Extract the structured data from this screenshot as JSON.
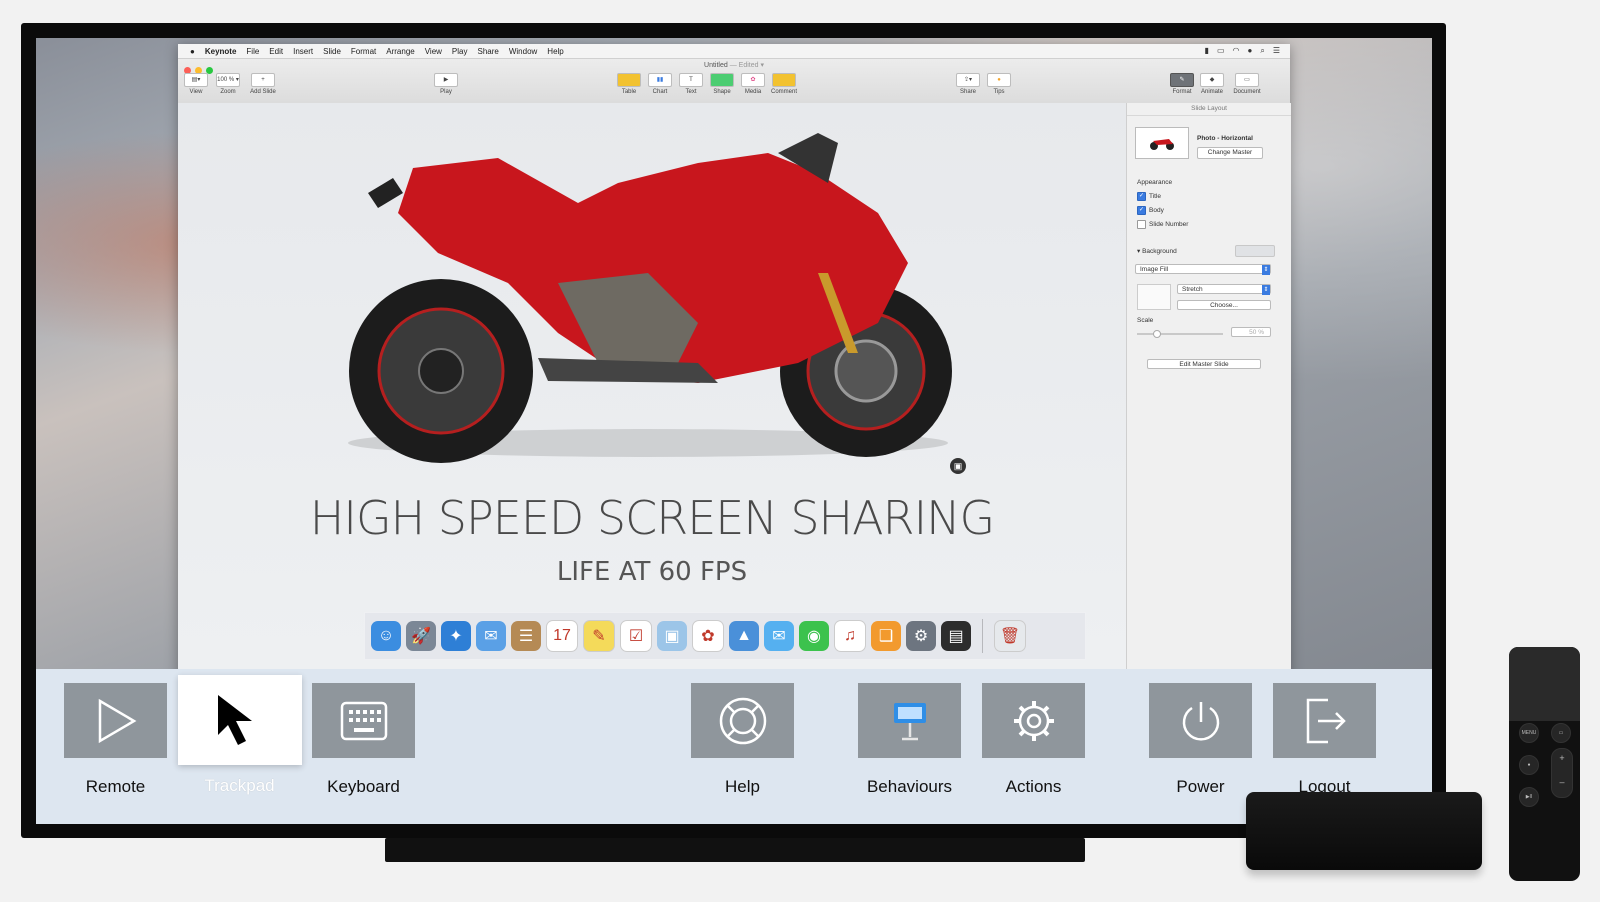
{
  "menubar": {
    "apple": "",
    "app_name": "Keynote",
    "menus": [
      "File",
      "Edit",
      "Insert",
      "Slide",
      "Format",
      "Arrange",
      "View",
      "Play",
      "Share",
      "Window",
      "Help"
    ]
  },
  "document": {
    "title": "Untitled",
    "edited": "— Edited ▾"
  },
  "toolbar": {
    "view": "View",
    "zoom": "Zoom",
    "zoom_value": "100 % ▾",
    "add_slide": "Add Slide",
    "play": "Play",
    "table": "Table",
    "chart": "Chart",
    "text": "Text",
    "shape": "Shape",
    "media": "Media",
    "comment": "Comment",
    "share": "Share",
    "tips": "Tips",
    "format": "Format",
    "animate": "Animate",
    "document": "Document"
  },
  "slide": {
    "title": "HIGH SPEED SCREEN SHARING",
    "subtitle": "LIFE AT 60 FPS"
  },
  "inspector": {
    "header": "Slide Layout",
    "master_name": "Photo - Horizontal",
    "change_master": "Change Master",
    "appearance": "Appearance",
    "title": "Title",
    "body": "Body",
    "slide_number": "Slide Number",
    "title_checked": true,
    "body_checked": true,
    "slide_number_checked": false,
    "background": "Background",
    "fill": "Image Fill",
    "stretch": "Stretch",
    "choose": "Choose...",
    "scale": "Scale",
    "scale_value": "50 %",
    "edit_master": "Edit Master Slide"
  },
  "dock": [
    {
      "name": "finder",
      "color": "#3b8de0",
      "glyph": "☺"
    },
    {
      "name": "launchpad",
      "color": "#7b8796",
      "glyph": "🚀"
    },
    {
      "name": "safari",
      "color": "#2e7fd6",
      "glyph": "✦"
    },
    {
      "name": "mail",
      "color": "#5aa0e6",
      "glyph": "✉"
    },
    {
      "name": "contacts",
      "color": "#b58a55",
      "glyph": "☰"
    },
    {
      "name": "calendar",
      "color": "#ffffff",
      "glyph": "17"
    },
    {
      "name": "notes",
      "color": "#f4da5a",
      "glyph": "✎"
    },
    {
      "name": "reminders",
      "color": "#ffffff",
      "glyph": "☑"
    },
    {
      "name": "preview",
      "color": "#9cc5e8",
      "glyph": "▣"
    },
    {
      "name": "photos",
      "color": "#ffffff",
      "glyph": "✿"
    },
    {
      "name": "keynote",
      "color": "#4a90d9",
      "glyph": "▲"
    },
    {
      "name": "messages",
      "color": "#55b0f0",
      "glyph": "✉"
    },
    {
      "name": "facetime",
      "color": "#3cc24d",
      "glyph": "◉"
    },
    {
      "name": "itunes",
      "color": "#ffffff",
      "glyph": "♫"
    },
    {
      "name": "ibooks",
      "color": "#f29a2e",
      "glyph": "❑"
    },
    {
      "name": "system-preferences",
      "color": "#6d7580",
      "glyph": "⚙"
    },
    {
      "name": "app-store",
      "color": "#2d2d2d",
      "glyph": "▤"
    },
    {
      "name": "trash",
      "color": "#e6e9ec",
      "glyph": "🗑"
    }
  ],
  "controls": [
    {
      "id": "remote",
      "label": "Remote",
      "icon": "play-icon",
      "selected": false
    },
    {
      "id": "trackpad",
      "label": "Trackpad",
      "icon": "cursor-icon",
      "selected": true
    },
    {
      "id": "keyboard",
      "label": "Keyboard",
      "icon": "keyboard-icon",
      "selected": false
    },
    {
      "id": "help",
      "label": "Help",
      "icon": "lifebuoy-icon",
      "selected": false
    },
    {
      "id": "behaviours",
      "label": "Behaviours",
      "icon": "keynote-icon",
      "selected": false
    },
    {
      "id": "actions",
      "label": "Actions",
      "icon": "gear-icon",
      "selected": false
    },
    {
      "id": "power",
      "label": "Power",
      "icon": "power-icon",
      "selected": false
    },
    {
      "id": "logout",
      "label": "Logout",
      "icon": "logout-icon",
      "selected": false
    }
  ],
  "remote": {
    "menu": "MENU",
    "play_pause": "▶II",
    "plus": "+",
    "minus": "–"
  }
}
